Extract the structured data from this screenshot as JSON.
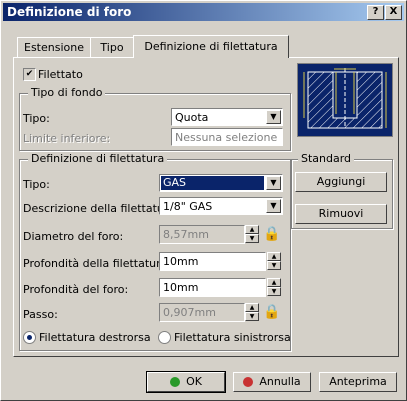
{
  "window": {
    "title": "Definizione di foro",
    "help_label": "?",
    "close_label": "X"
  },
  "tabs": [
    {
      "label": "Estensione"
    },
    {
      "label": "Tipo"
    },
    {
      "label": "Definizione di filettatura"
    }
  ],
  "threaded": {
    "label": "Filettato",
    "checked": true
  },
  "bottom_type": {
    "legend": "Tipo di fondo",
    "type_label": "Tipo:",
    "type_value": "Quota",
    "limit_label": "Limite inferiore:",
    "limit_value": "Nessuna selezione"
  },
  "thread_def": {
    "legend": "Definizione di filettatura",
    "type_label": "Tipo:",
    "type_value": "GAS",
    "desc_label": "Descrizione della filettatura:",
    "desc_value": "1/8\" GAS",
    "diameter_label": "Diametro del foro:",
    "diameter_value": "8,57mm",
    "thread_depth_label": "Profondità della filettatura:",
    "thread_depth_value": "10mm",
    "hole_depth_label": "Profondità del foro:",
    "hole_depth_value": "10mm",
    "pitch_label": "Passo:",
    "pitch_value": "0,907mm",
    "right_label": "Filettatura destrorsa",
    "left_label": "Filettatura sinistrorsa",
    "right_selected": true
  },
  "standard": {
    "legend": "Standard",
    "add_label": "Aggiungi",
    "remove_label": "Rimuovi"
  },
  "footer": {
    "ok_label": "OK",
    "cancel_label": "Annulla",
    "preview_label": "Anteprima"
  },
  "colors": {
    "ok_dot": "#2a9a2a",
    "cancel_dot": "#c83232",
    "preview_bg": "#0a246a",
    "preview_line": "#d8c84a"
  }
}
